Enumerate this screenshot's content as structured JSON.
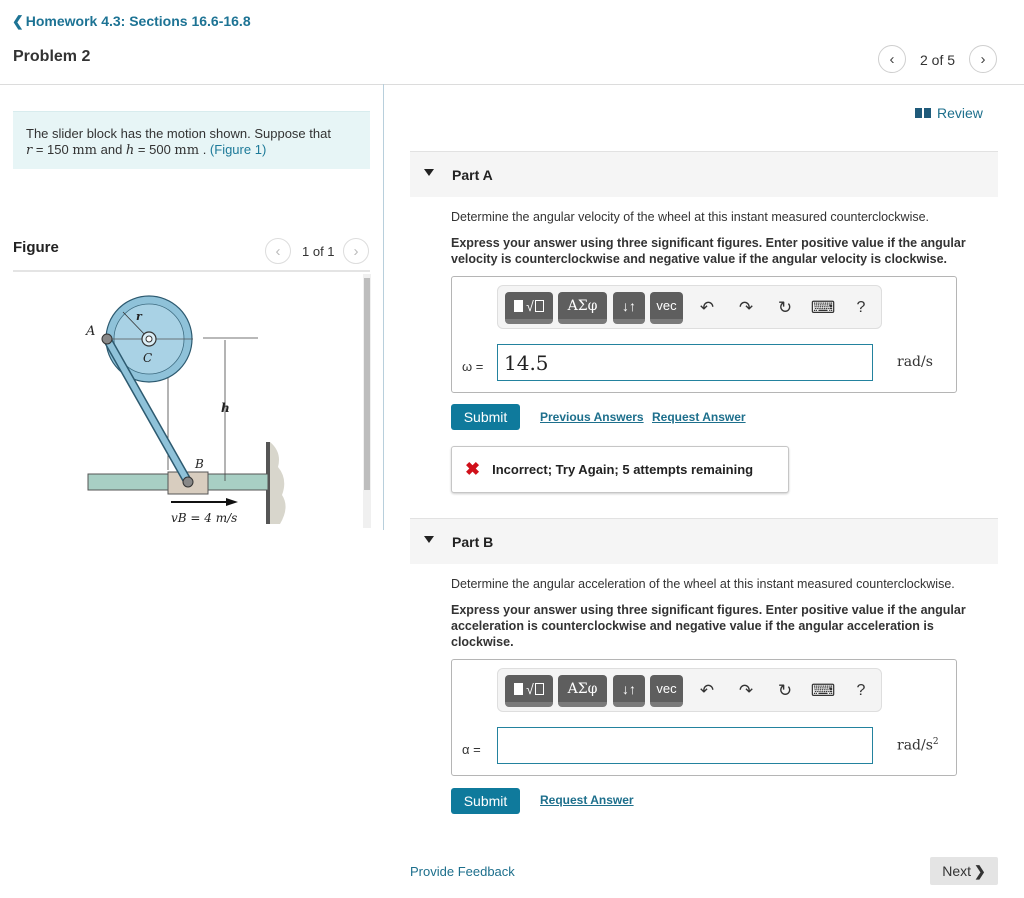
{
  "header": {
    "back_link": "Homework 4.3: Sections 16.6-16.8",
    "problem_title": "Problem 2",
    "pager": {
      "current": "2 of 5"
    }
  },
  "intro": {
    "text_1": "The slider block has the motion shown. Suppose that",
    "r_var": "r",
    "r_value": " = 150 ",
    "r_unit": "mm",
    "and": " and ",
    "h_var": "h",
    "h_value": " = 500 ",
    "h_unit": "mm",
    "period": " . ",
    "figure_link": "(Figure 1)"
  },
  "figure": {
    "title": "Figure",
    "pager": "1 of 1",
    "labels": {
      "A": "A",
      "B": "B",
      "C": "C",
      "r": "r",
      "h": "h",
      "vB": "vB = 4 m/s"
    }
  },
  "review_link": "Review",
  "parts": [
    {
      "title": "Part A",
      "question": "Determine the angular velocity of the wheel at this instant measured counterclockwise.",
      "instructions": "Express your answer using three significant figures. Enter positive value if the angular velocity is counterclockwise and negative value if the angular velocity is clockwise.",
      "variable": "ω =",
      "input_value": "14.5",
      "unit": "rad/s",
      "submit_label": "Submit",
      "previous_answers_label": "Previous Answers",
      "request_answer_label": "Request Answer",
      "feedback": {
        "icon": "✖",
        "message": "Incorrect; Try Again; 5 attempts remaining"
      }
    },
    {
      "title": "Part B",
      "question": "Determine the angular acceleration of the wheel at this instant measured counterclockwise.",
      "instructions": "Express your answer using three significant figures. Enter positive value if the angular acceleration is counterclockwise and negative value if the angular acceleration is clockwise.",
      "variable": "α =",
      "input_value": "",
      "unit": "rad/s",
      "unit_exp": "2",
      "submit_label": "Submit",
      "request_answer_label": "Request Answer"
    }
  ],
  "toolbar": {
    "templates": "√",
    "greek": "ΑΣφ",
    "arrows": "↓↑",
    "vec": "vec",
    "undo": "↶",
    "redo": "↷",
    "reset": "↻",
    "keyboard": "⌨",
    "help": "?"
  },
  "footer": {
    "provide_feedback": "Provide Feedback",
    "next": "Next"
  }
}
